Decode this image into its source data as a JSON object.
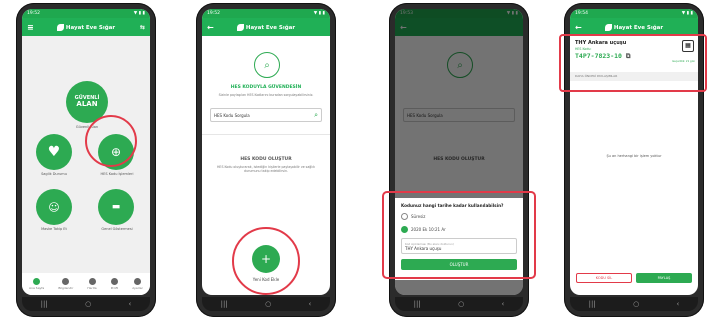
{
  "app_title": "Hayat Eve Sığar",
  "status_bar": {
    "p1_time": "19:52",
    "p2_time": "19:52",
    "p3_time": "19:53",
    "p4_time": "19:54"
  },
  "phone1": {
    "tiles": [
      "Güvenli Alan",
      "Saglik Durumu",
      "HES Kodu İşlemleri",
      "Maske Takip Et",
      "Genel Göstermesi"
    ],
    "logo_text": {
      "line1": "GÜVENLİ",
      "line2": "ALAN"
    },
    "tabs": [
      "Ana Sayfa",
      "Bilgilendir",
      "Harita",
      "Profil",
      "Ayarlar"
    ]
  },
  "phone2": {
    "section1_title": "HES KODUYLA GÜVENDESİN",
    "section1_text": "Sizinle paylaşılan HES Kodlarını buradan sorgulayabilirsiniz.",
    "query_placeholder": "HES Kodu Sorgula",
    "section2_title": "HES KODU OLUŞTUR",
    "section2_text": "HES Kodu oluşturarak, istediğin kişilerle paylaşabilir ve sağlık durumunu takip edebilirsin.",
    "fab_label": "Yeni Kod Ekle"
  },
  "phone3": {
    "dialog_title": "Kodunuz hangi tarihe kadar kullanılabilsin?",
    "option1": "Süresiz",
    "option2": "2020 Ek 10:21 Ar",
    "field_label": "Kod Açıklaması (Bu alanı doldurun)",
    "field_value": "THY Ankara uçuşu",
    "button": "OLUŞTUR",
    "bg_query": "HES Kodu Sorgula",
    "bg_title": "HES KODU OLUŞTUR"
  },
  "phone4": {
    "card_title": "THY Ankara uçuşu",
    "code_label": "HES Kodu:",
    "code": "T4P7-7823-10",
    "expiry": "Geçerlilik: 21 gün",
    "section": "DAHA ÖNCEKİ PAYLAŞIMLAR",
    "empty": "Şu an herhangi bir işlem yoktur",
    "btn_left": "KODU SİL",
    "btn_right": "PAYLAŞ"
  }
}
